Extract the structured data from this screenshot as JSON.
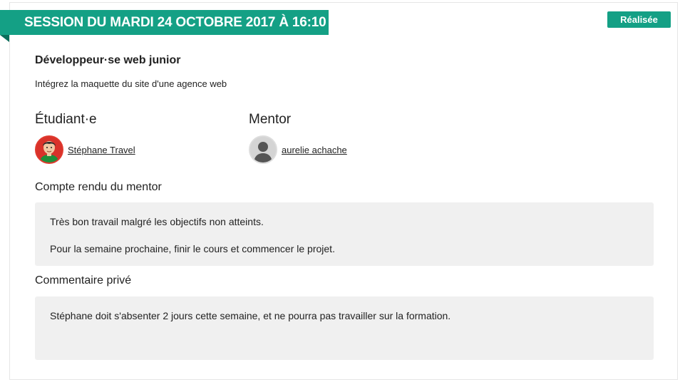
{
  "session": {
    "title": "SESSION DU MARDI 24 OCTOBRE 2017 À 16:10",
    "status": "Réalisée"
  },
  "course": {
    "title": "Développeur·se web junior",
    "project": "Intégrez la maquette du site d'une agence web"
  },
  "student": {
    "heading": "Étudiant·e",
    "name": "Stéphane Travel"
  },
  "mentor": {
    "heading": "Mentor",
    "name": "aurelie achache"
  },
  "report": {
    "title": "Compte rendu du mentor",
    "paragraphs": [
      "Très bon travail malgré les objectifs non atteints.",
      "Pour la semaine prochaine, finir le cours et commencer le projet."
    ]
  },
  "private_comment": {
    "title": "Commentaire privé",
    "text": "Stéphane doit s'absenter 2 jours cette semaine, et ne pourra pas travailler sur la formation."
  },
  "colors": {
    "accent": "#14a085",
    "box_background": "#f0f0f0"
  }
}
